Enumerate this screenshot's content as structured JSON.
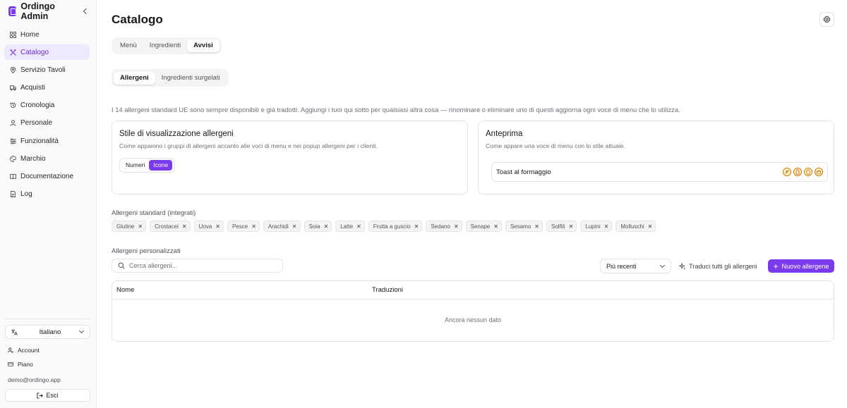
{
  "app": {
    "name": "Ordingo Admin"
  },
  "sidebar": {
    "items": [
      {
        "label": "Home",
        "icon": "grid-icon"
      },
      {
        "label": "Catalogo",
        "icon": "utensils-icon",
        "active": true
      },
      {
        "label": "Servizio Tavoli",
        "icon": "map-pin-icon"
      },
      {
        "label": "Acquisti",
        "icon": "truck-icon"
      },
      {
        "label": "Cronologia",
        "icon": "history-icon"
      },
      {
        "label": "Personale",
        "icon": "user-icon"
      },
      {
        "label": "Funzionalità",
        "icon": "sliders-icon"
      },
      {
        "label": "Marchio",
        "icon": "palette-icon"
      },
      {
        "label": "Documentazione",
        "icon": "book-icon"
      },
      {
        "label": "Log",
        "icon": "file-text-icon"
      }
    ],
    "language": "Italiano",
    "account_label": "Account",
    "plan_label": "Piano",
    "email": "demo@ordingo.app",
    "logout_label": "Esci"
  },
  "page": {
    "title": "Catalogo",
    "tabs": [
      {
        "label": "Menù"
      },
      {
        "label": "Ingredienti"
      },
      {
        "label": "Avvisi",
        "active": true
      }
    ],
    "subtabs": [
      {
        "label": "Allergeni",
        "active": true
      },
      {
        "label": "Ingredienti surgelati"
      }
    ],
    "intro": "I 14 allergeni standard UE sono sempre disponibili e già tradotti. Aggiungi i tuoi qui sotto per qualsiasi altra cosa — rinominare o eliminare uno di questi aggiorna ogni voce di menu che lo utilizza."
  },
  "display_card": {
    "title": "Stile di visualizzazione allergeni",
    "desc": "Come appaiono i gruppi di allergeni accanto alle voci di menu e nei popup allergeni per i clienti.",
    "options": [
      {
        "label": "Numeri"
      },
      {
        "label": "Icone",
        "active": true
      }
    ]
  },
  "preview_card": {
    "title": "Anteprima",
    "desc": "Come appare una voce di menu con lo stile attuale.",
    "item_name": "Toast al formaggio",
    "icons": [
      "wheat-icon",
      "milk-icon",
      "egg-icon",
      "pot-icon"
    ]
  },
  "standard": {
    "label": "Allergeni standard (integrati)",
    "chips": [
      "Glutine",
      "Crostacei",
      "Uova",
      "Pesce",
      "Arachidi",
      "Soia",
      "Latte",
      "Frutta a guscio",
      "Sedano",
      "Senape",
      "Sesamo",
      "Solfiti",
      "Lupini",
      "Molluschi"
    ]
  },
  "custom": {
    "label": "Allergeni personalizzati",
    "search_placeholder": "Cerca allergeni...",
    "sort_value": "Più recenti",
    "translate_label": "Traduci tutti gli allergeni",
    "new_label": "Nuovo allergene",
    "columns": [
      "Nome",
      "Traduzioni"
    ],
    "empty": "Ancora nessun dato"
  },
  "colors": {
    "accent": "#7c3aed",
    "accent_soft": "#ede9fe"
  }
}
